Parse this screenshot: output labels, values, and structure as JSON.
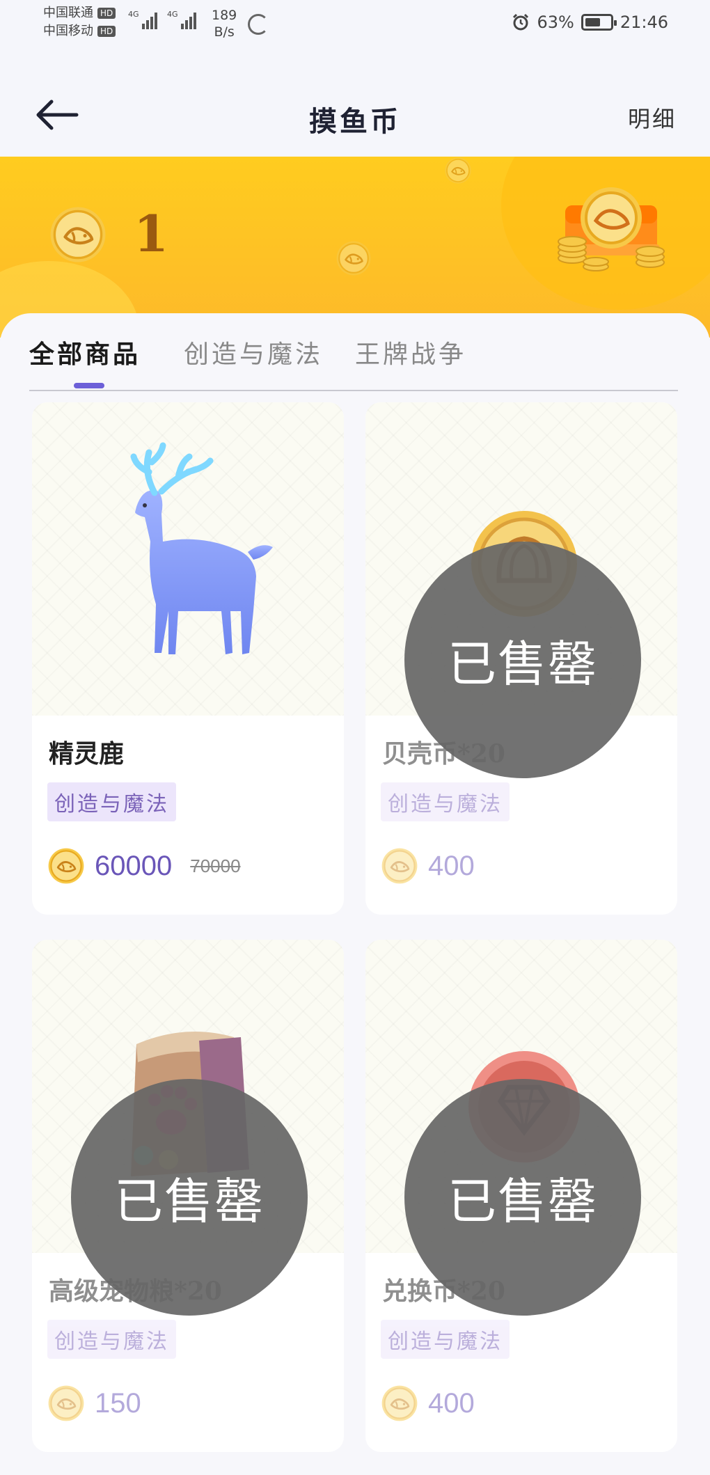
{
  "status_bar": {
    "carrier_1": "中国联通",
    "carrier_2": "中国移动",
    "hd_badge": "HD",
    "net_type_1": "4G",
    "net_type_2": "4G",
    "speed_value": "189",
    "speed_unit": "B/s",
    "battery": "63%",
    "battery_level": 0.63,
    "time": "21:46"
  },
  "header": {
    "title": "摸鱼币",
    "detail_label": "明细"
  },
  "banner": {
    "balance": "1"
  },
  "tabs": [
    {
      "label": "全部商品",
      "active": true
    },
    {
      "label": "创造与魔法",
      "active": false
    },
    {
      "label": "王牌战争",
      "active": false
    }
  ],
  "products": [
    {
      "name": "精灵鹿",
      "tag": "创造与魔法",
      "price": "60000",
      "old_price": "70000",
      "sold_out": false,
      "image": "deer-image"
    },
    {
      "name": "贝壳币*20",
      "tag": "创造与魔法",
      "price": "400",
      "old_price": "",
      "sold_out": true,
      "sold_label": "已售罄",
      "image": "shell-coin-image"
    },
    {
      "name": "高级宠物粮*20",
      "tag": "创造与魔法",
      "price": "150",
      "old_price": "",
      "sold_out": true,
      "sold_label": "已售罄",
      "image": "pet-food-bag-image"
    },
    {
      "name": "兑换币*20",
      "tag": "创造与魔法",
      "price": "400",
      "old_price": "",
      "sold_out": true,
      "sold_label": "已售罄",
      "image": "exchange-coin-image"
    }
  ],
  "colors": {
    "accent": "#6c5fd8",
    "banner": "#ffcc1f",
    "tag_bg": "#ece5fb",
    "price": "#6a56b8"
  }
}
